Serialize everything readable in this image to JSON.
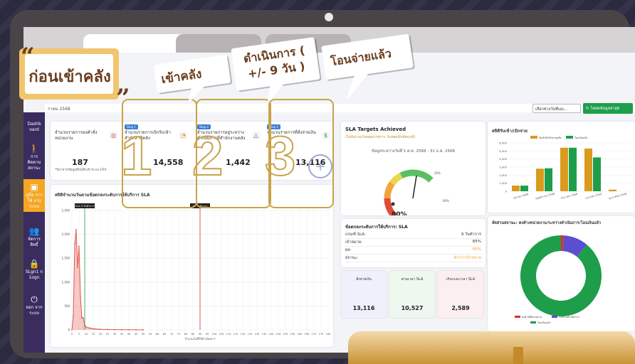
{
  "header": {
    "date_range": "ราคม 2568",
    "select_label": "เลือกช่วงวันที่เอง...",
    "refresh_label": "โหลดข้อมูลล่าสุด"
  },
  "sidebar": [
    {
      "label": "Dashb oard",
      "icon": "dashboard-icon"
    },
    {
      "label": "การ ติดตาม สถานะ",
      "icon": "walk-icon"
    },
    {
      "label": "คู่มือ การใช้ งาน ระบบ",
      "icon": "manual-icon"
    },
    {
      "label": "จัดการ สิทธิ์",
      "icon": "users-icon"
    },
    {
      "label": "SLgn1 n 1ogn",
      "icon": "lock-icon"
    },
    {
      "label": "ออก จาก ระบบ",
      "icon": "power-icon"
    }
  ],
  "stats": [
    {
      "title": "จำนวนรายการลงคำสั่งหน่วยงาน",
      "value": "187",
      "note": "*ปีมาจากข้อมูลที่บันทึกเข้าระบบ ERP",
      "step": ""
    },
    {
      "title": "จำนวนรายการเบิกรับเข้าสำนักงานคลัง",
      "value": "14,558",
      "note": "",
      "step": "Step 1"
    },
    {
      "title": "จำนวนรายการอยู่ระหว่างดำเนินการที่สำนักงานคลัง",
      "value": "1,442",
      "note": "",
      "step": "Step 2"
    },
    {
      "title": "จำนวนรายการที่สั่งจ่ายเงิน",
      "value": "13,116",
      "note": "",
      "step": "Step 3"
    }
  ],
  "gold_numbers": [
    "1",
    "2",
    "3"
  ],
  "overlay": {
    "title": "ก่อนเข้าคลัง",
    "callouts": [
      "เข้าคลัง",
      "ดำเนินการ ( +/- 9 วัน )",
      "โอนจ่ายแล้ว"
    ]
  },
  "sla": {
    "title": "SLA Targets Achieved",
    "subtitle": "(ไม่นับรวมวันหยุดราชการ วันหยุดนักขัตฤกษ์)",
    "range": "ข้อมูลระหว่างวันที่ 1 ต.ค. 2568 - 31 ธ.ค. 2568",
    "gauge_value": "80%",
    "gauge_fraction": 0.8,
    "tick_left": "20%",
    "tick_right": "60%",
    "detail_title": "ข้อตกลงระดับการให้บริการ: SLA",
    "rows": [
      [
        "เกณฑ์ SLA:",
        "9 วันทำการ"
      ],
      [
        "เป้าหมาย:",
        "85%"
      ],
      [
        "ผล:",
        "80%"
      ],
      [
        "สถานะ:",
        "ต่ำกว่าเป้าหมาย"
      ]
    ],
    "mini": [
      {
        "label": "สั่งจ่ายเงิน",
        "value": "13,116"
      },
      {
        "label": "ตามเวลา SLA",
        "value": "10,527"
      },
      {
        "label": "เกินระยะเวลา SLA",
        "value": "2,589"
      }
    ]
  },
  "line_chart": {
    "title": "สถิติจำนวนวันตามข้อตกลงระดับการให้บริการ SLA",
    "marker_a": "SLA 9 วันทำการ",
    "marker_b": "90 วันทำการ",
    "xlabel": "จำนวนวันที่ใช้ดำเนินการ"
  },
  "chart_data": [
    {
      "type": "line",
      "title": "สถิติจำนวนวันตามข้อตกลงระดับการให้บริการ SLA",
      "xlabel": "จำนวนวันที่ใช้ดำเนินการ",
      "ylim": [
        0,
        2500
      ],
      "y_ticks": [
        "0",
        "500",
        "1,000",
        "1,500",
        "2,000",
        "2,500"
      ],
      "x_ticks": [
        "0",
        "5",
        "10",
        "15",
        "20",
        "25",
        "30",
        "35",
        "40",
        "45",
        "50",
        "55",
        "60",
        "65",
        "70",
        "75",
        "80",
        "85",
        "90",
        "95",
        "100",
        "105",
        "110",
        "115",
        "120",
        "125",
        "130",
        "135",
        "140",
        "145",
        "150",
        "155",
        "160",
        "165",
        "170",
        "175",
        "180"
      ],
      "x": [
        0,
        1,
        2,
        3,
        4,
        5,
        6,
        7,
        8,
        9,
        10,
        12,
        14,
        16,
        18,
        20,
        25,
        30,
        35,
        40,
        45,
        50
      ],
      "y": [
        0,
        300,
        1800,
        2100,
        1300,
        1750,
        700,
        250,
        250,
        100,
        60,
        40,
        30,
        20,
        15,
        12,
        8,
        6,
        4,
        3,
        2,
        1
      ]
    },
    {
      "type": "bar",
      "title": "สถิติรับเข้า/เบิกจ่าย",
      "series": [
        {
          "name": "รับเข้าสำนักงานคลัง",
          "color": "#d99a1e",
          "values": [
            700,
            2800,
            5400,
            5300,
            200
          ]
        },
        {
          "name": "โอนเงินแล้ว",
          "color": "#1e9e4a",
          "values": [
            700,
            2850,
            5400,
            4200,
            0
          ]
        }
      ],
      "categories": [
        "ตุลาคม 2568",
        "พฤศจิกายน 2568",
        "ธันวาคม 2568",
        "มกราคม 2569",
        "กุมภาพันธ์ 2569"
      ],
      "y_ticks": [
        "0",
        "1,000",
        "2,000",
        "3,000",
        "4,000",
        "5,000",
        "6,000"
      ],
      "ylim": [
        0,
        6000
      ]
    },
    {
      "type": "pie",
      "title": "สัดส่วนสถานะ: คงค้างหน่วยงาน/ระหว่างดำเนินการ/โอนเงินแล้ว",
      "labels": [
        "คงค้างที่หน่วยงาน",
        "ระหว่างดำเนินการ",
        "โอนเงินแล้ว"
      ],
      "values": [
        1.2,
        9.8,
        89
      ],
      "colors": [
        "#d9332b",
        "#5a4fcf",
        "#1e9e4a"
      ]
    }
  ]
}
